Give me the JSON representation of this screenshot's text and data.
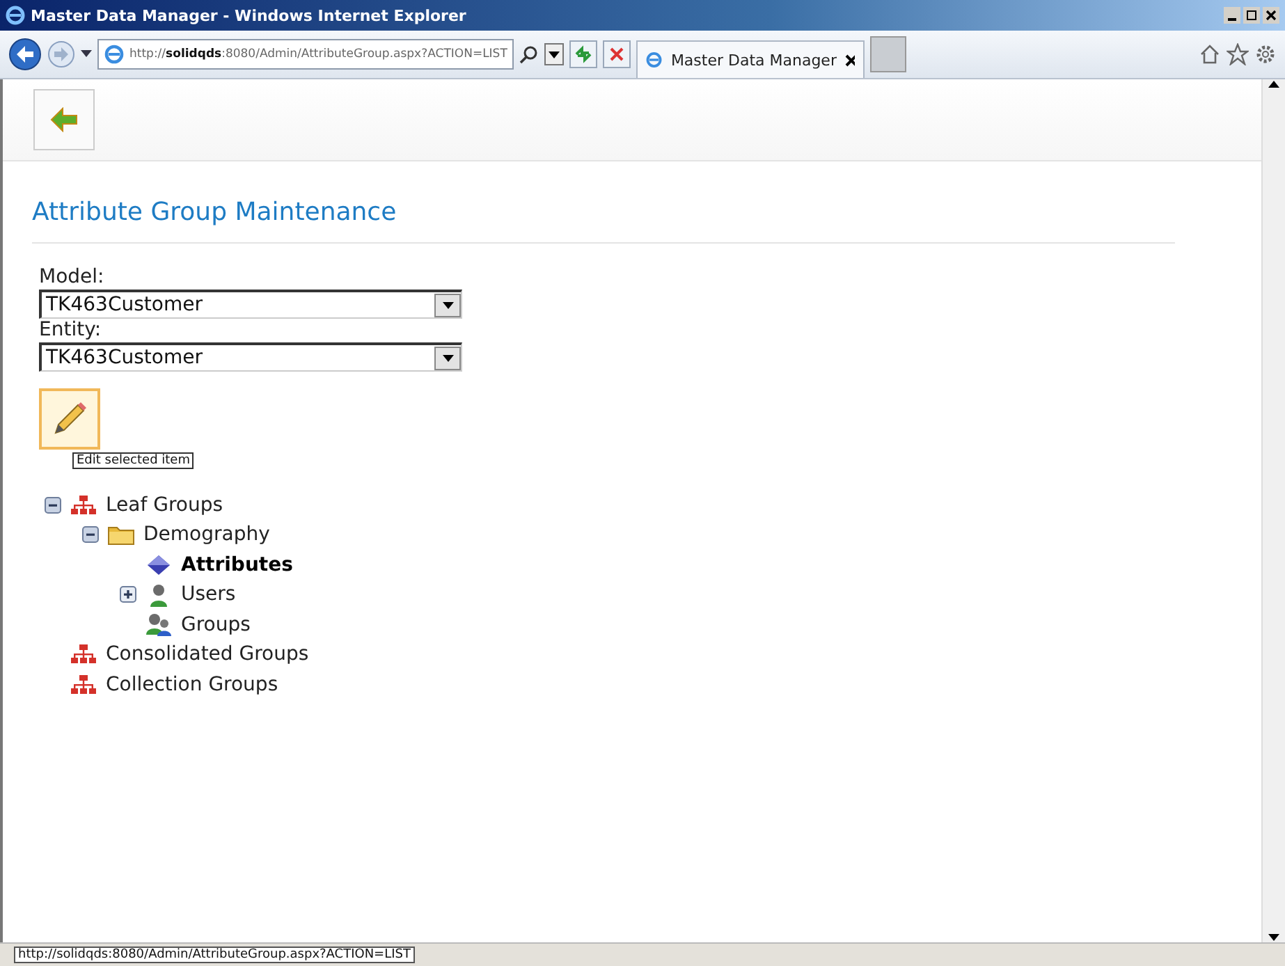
{
  "window": {
    "title": "Master Data Manager - Windows Internet Explorer"
  },
  "address_bar": {
    "url": "http://**solidqds**:8080/Admin/AttributeGroup.aspx?ACTION=LIST"
  },
  "tabs": [
    {
      "label": "Master Data Manager",
      "selected": true
    }
  ],
  "page": {
    "heading": "Attribute Group Maintenance",
    "fields": [
      {
        "label": "Model:",
        "value": "TK463Customer"
      },
      {
        "label": "Entity:",
        "value": "TK463Customer"
      }
    ],
    "tooltip": "Edit selected item"
  },
  "tree": [
    {
      "label": "Leaf Groups",
      "kind": "hierarchy",
      "expanded": true,
      "selected": false,
      "children": [
        {
          "label": "Demography",
          "kind": "folder",
          "expanded": true,
          "selected": false,
          "children": [
            {
              "label": "Attributes",
              "kind": "attribute",
              "selected": true
            },
            {
              "label": "Users",
              "kind": "user",
              "expanded": false,
              "selected": false
            },
            {
              "label": "Groups",
              "kind": "group",
              "selected": false
            }
          ]
        }
      ]
    },
    {
      "label": "Consolidated Groups",
      "kind": "hierarchy",
      "selected": false
    },
    {
      "label": "Collection Groups",
      "kind": "hierarchy",
      "selected": false
    }
  ],
  "status_bar": {
    "text": "http://solidqds:8080/Admin/AttributeGroup.aspx?ACTION=LIST"
  }
}
